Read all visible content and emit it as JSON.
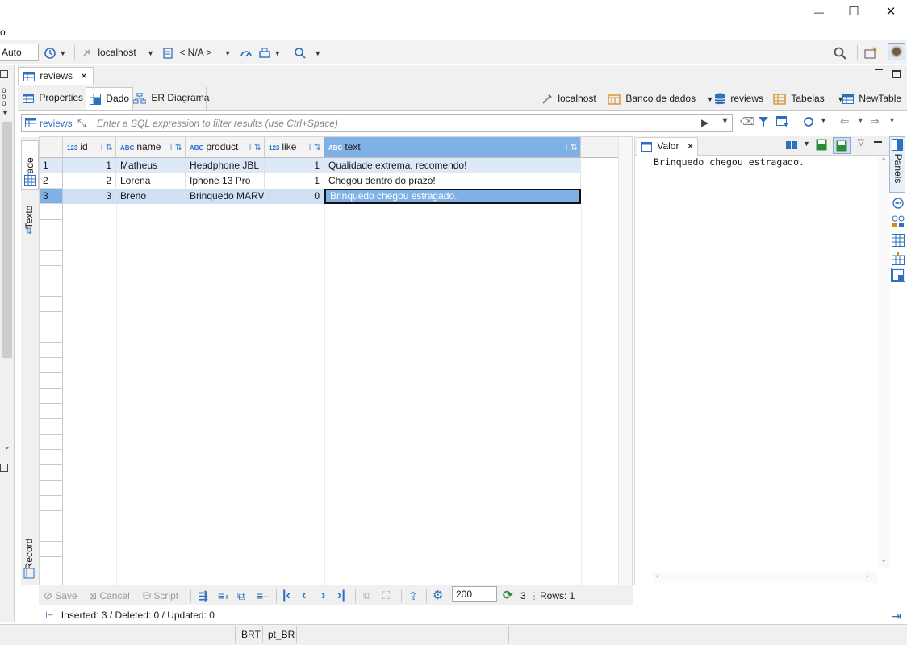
{
  "window": {
    "minimize_glyph": "—",
    "maximize_glyph": "☐",
    "close_glyph": "✕",
    "left_fragment": "o"
  },
  "toolbar": {
    "auto_value": "Auto",
    "connection": "localhost",
    "schema": "< N/A >"
  },
  "editor_tab": {
    "label": "reviews",
    "close_glyph": "✕"
  },
  "subtabs": [
    "Properties",
    "Dado",
    "ER Diagrama"
  ],
  "nav": {
    "connection": "localhost",
    "database": "Banco de dados",
    "table": "reviews",
    "tables": "Tabelas",
    "new_table": "NewTable"
  },
  "filter": {
    "table_label": "reviews",
    "placeholder": "Enter a SQL expression to filter results (use Ctrl+Space)"
  },
  "vtabs": {
    "grid": "Grade",
    "text": "Texto",
    "record": "Record"
  },
  "grid": {
    "columns": [
      {
        "type": "123",
        "name": "id"
      },
      {
        "type": "ABC",
        "name": "name"
      },
      {
        "type": "ABC",
        "name": "product"
      },
      {
        "type": "123",
        "name": "like"
      },
      {
        "type": "ABC",
        "name": "text"
      }
    ],
    "rows": [
      {
        "num": "1",
        "id": "1",
        "name": "Matheus",
        "product": "Headphone JBL",
        "like": "1",
        "text": "Qualidade extrema, recomendo!"
      },
      {
        "num": "2",
        "id": "2",
        "name": "Lorena",
        "product": "Iphone 13 Pro",
        "like": "1",
        "text": "Chegou dentro do prazo!"
      },
      {
        "num": "3",
        "id": "3",
        "name": "Breno",
        "product": "Brinquedo MARV",
        "like": "0",
        "text": "Brinquedo chegou estragado."
      }
    ],
    "selected_row": 3
  },
  "value_panel": {
    "tab_label": "Valor",
    "close_glyph": "✕",
    "content": "Brinquedo chegou estragado."
  },
  "panels_label": "Panels",
  "bottom": {
    "save": "Save",
    "cancel": "Cancel",
    "script": "Script",
    "fetch_size": "200",
    "count": "3",
    "rows": "Rows: 1",
    "status": "Inserted: 3 / Deleted: 0 / Updated: 0"
  },
  "statusbar": {
    "timezone": "BRT",
    "locale": "pt_BR"
  },
  "colors": {
    "accent": "#2f6fc0",
    "header_selected": "#7fb0e6",
    "row_selected": "#cfe0f4",
    "row_highlight": "#dde9f7",
    "save_green": "#2e8b3e"
  }
}
